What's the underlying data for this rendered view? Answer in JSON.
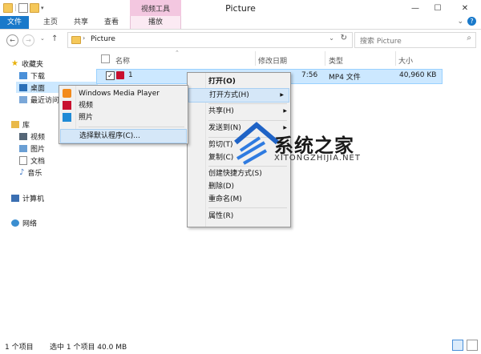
{
  "titlebar": {
    "title": "Picture",
    "contextual_group": "视频工具",
    "colors": {
      "contextual": "#f3c7e0",
      "file_tab": "#1979ca"
    }
  },
  "ribbon": {
    "tabs": [
      {
        "label": "文件"
      },
      {
        "label": "主页"
      },
      {
        "label": "共享"
      },
      {
        "label": "查看"
      },
      {
        "label": "播放"
      }
    ]
  },
  "address": {
    "path": "Picture",
    "search_placeholder": "搜索 Picture"
  },
  "nav": {
    "items": [
      {
        "label": "收藏夹",
        "icon": "star-icon"
      },
      {
        "label": "下载",
        "icon": "download-folder-icon"
      },
      {
        "label": "桌面",
        "icon": "desktop-icon"
      },
      {
        "label": "最近访问",
        "icon": "recent-icon"
      },
      {
        "label": "库",
        "icon": "library-icon"
      },
      {
        "label": "视频",
        "icon": "video-library-icon"
      },
      {
        "label": "图片",
        "icon": "pictures-library-icon"
      },
      {
        "label": "文档",
        "icon": "documents-library-icon"
      },
      {
        "label": "音乐",
        "icon": "music-library-icon"
      },
      {
        "label": "计算机",
        "icon": "computer-icon"
      },
      {
        "label": "网络",
        "icon": "network-icon"
      }
    ]
  },
  "columns": {
    "name": "名称",
    "date": "修改日期",
    "type": "类型",
    "size": "大小"
  },
  "file": {
    "name": "1",
    "time": "7:56",
    "type": "MP4 文件",
    "size": "40,960 KB"
  },
  "context_menu": {
    "items": [
      {
        "label": "打开(O)",
        "bold": true
      },
      {
        "label": "打开方式(H)",
        "submenu": true
      },
      {
        "label": "共享(H)",
        "submenu": true
      },
      {
        "label": "发送到(N)",
        "submenu": true
      },
      {
        "label": "剪切(T)"
      },
      {
        "label": "复制(C)"
      },
      {
        "label": "创建快捷方式(S)"
      },
      {
        "label": "删除(D)"
      },
      {
        "label": "重命名(M)"
      },
      {
        "label": "属性(R)"
      }
    ]
  },
  "open_with_menu": {
    "items": [
      {
        "label": "Windows Media Player",
        "icon": "windows-media-player-icon"
      },
      {
        "label": "视频",
        "icon": "video-app-icon"
      },
      {
        "label": "照片",
        "icon": "photos-app-icon"
      },
      {
        "label": "选择默认程序(C)..."
      }
    ]
  },
  "watermark": {
    "title": "系统之家",
    "subtitle": "XITONGZHIJIA.NET"
  },
  "status": {
    "item_count": "1 个项目",
    "selected": "选中 1 个项目  40.0 MB"
  }
}
